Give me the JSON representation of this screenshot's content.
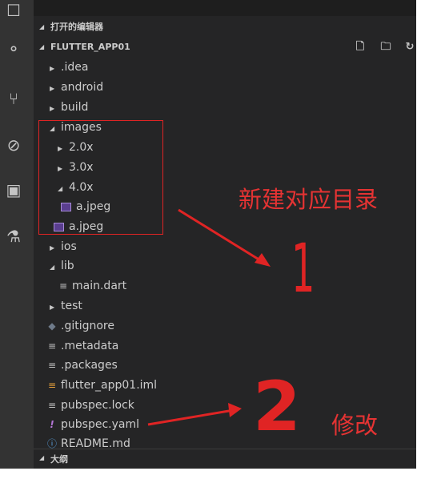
{
  "sections": {
    "open_editors": "打开的编辑器",
    "project": "FLUTTER_APP01",
    "outline": "大纲"
  },
  "toolbar": {
    "new_file_icon": "new-file-icon",
    "new_folder_icon": "new-folder-icon",
    "refresh_icon": "refresh-icon"
  },
  "tree": {
    "idea": ".idea",
    "android": "android",
    "build": "build",
    "images": "images",
    "dir_2x": "2.0x",
    "dir_3x": "3.0x",
    "dir_4x": "4.0x",
    "img_4x": "a.jpeg",
    "img_root": "a.jpeg",
    "ios": "ios",
    "lib": "lib",
    "main_dart": "main.dart",
    "test": "test",
    "gitignore": ".gitignore",
    "metadata": ".metadata",
    "packages": ".packages",
    "iml": "flutter_app01.iml",
    "lock": "pubspec.lock",
    "yaml": "pubspec.yaml",
    "readme": "README.md"
  },
  "annotations": {
    "create_dir": "新建对应目录",
    "number_one": "1",
    "number_two": "2",
    "modify": "修改"
  },
  "colors": {
    "annotation_red": "#e02424",
    "sidebar_bg": "#252526",
    "activity_bg": "#333333"
  }
}
